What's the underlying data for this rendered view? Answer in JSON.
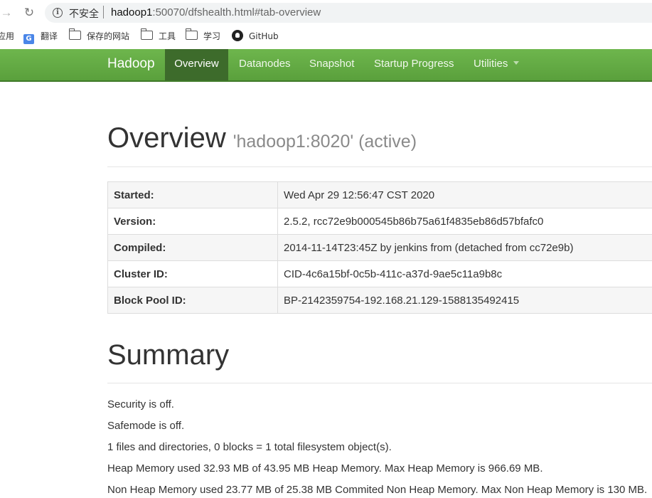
{
  "browser": {
    "insecure_label": "不安全",
    "url_host": "hadoop1",
    "url_rest": ":50070/dfshealth.html#tab-overview"
  },
  "bookmarks": [
    {
      "label": "应用"
    },
    {
      "label": "翻译"
    },
    {
      "label": "保存的网站"
    },
    {
      "label": "工具"
    },
    {
      "label": "学习"
    },
    {
      "label": "GitHub"
    }
  ],
  "navbar": {
    "brand": "Hadoop",
    "tabs": [
      {
        "label": "Overview",
        "active": true
      },
      {
        "label": "Datanodes"
      },
      {
        "label": "Snapshot"
      },
      {
        "label": "Startup Progress"
      },
      {
        "label": "Utilities"
      }
    ],
    "colors": {
      "bar": "#62aa44",
      "active": "#3d6b2b"
    }
  },
  "overview": {
    "title": "Overview",
    "subtitle": "'hadoop1:8020' (active)",
    "rows": [
      {
        "key": "Started:",
        "value": "Wed Apr 29 12:56:47 CST 2020"
      },
      {
        "key": "Version:",
        "value": "2.5.2, rcc72e9b000545b86b75a61f4835eb86d57bfafc0"
      },
      {
        "key": "Compiled:",
        "value": "2014-11-14T23:45Z by jenkins from (detached from cc72e9b)"
      },
      {
        "key": "Cluster ID:",
        "value": "CID-4c6a15bf-0c5b-411c-a37d-9ae5c11a9b8c"
      },
      {
        "key": "Block Pool ID:",
        "value": "BP-2142359754-192.168.21.129-1588135492415"
      }
    ]
  },
  "summary": {
    "title": "Summary",
    "lines": [
      "Security is off.",
      "Safemode is off.",
      "1 files and directories, 0 blocks = 1 total filesystem object(s).",
      "Heap Memory used 32.93 MB of 43.95 MB Heap Memory. Max Heap Memory is 966.69 MB.",
      "Non Heap Memory used 23.77 MB of 25.38 MB Commited Non Heap Memory. Max Non Heap Memory is 130 MB."
    ]
  }
}
